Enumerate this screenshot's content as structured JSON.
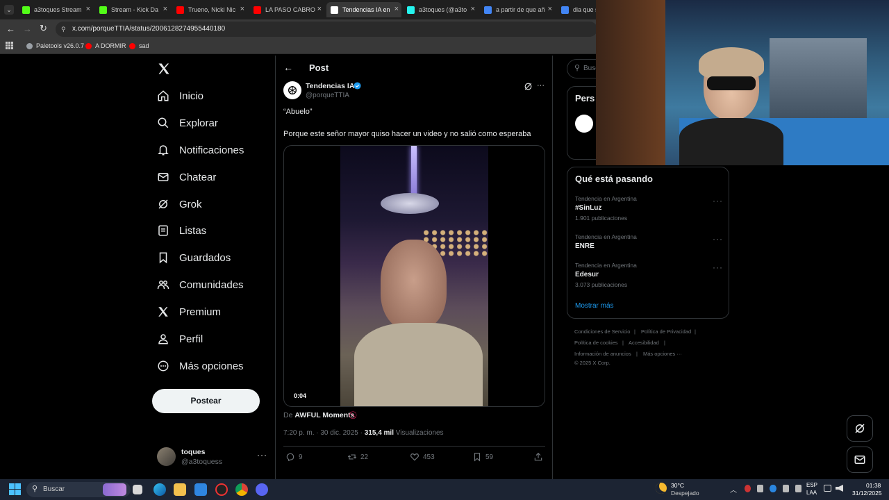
{
  "browser": {
    "tabs": [
      {
        "label": "a3toques Stream",
        "color": "#53fc18"
      },
      {
        "label": "Stream - Kick Da",
        "color": "#53fc18"
      },
      {
        "label": "Trueno, Nicki Nic",
        "color": "#ff0000"
      },
      {
        "label": "LA PASO CABRO",
        "color": "#ff0000"
      },
      {
        "label": "Tendencias IA en",
        "color": "#ffffff"
      },
      {
        "label": "a3toques (@a3to",
        "color": "#25f4ee"
      },
      {
        "label": "a partir de que añ",
        "color": "#4285f4"
      },
      {
        "label": "dia que se",
        "color": "#4285f4"
      }
    ],
    "url": "x.com/porqueTTIA/status/2006128274955440180",
    "bookmarks": [
      {
        "label": "Paletools v26.0.7",
        "color": "#9aa0a6"
      },
      {
        "label": "A DORMIR",
        "color": "#ff0000"
      },
      {
        "label": "sad",
        "color": "#ff0000"
      }
    ]
  },
  "nav": {
    "items": [
      {
        "label": "Inicio",
        "icon": "home-icon"
      },
      {
        "label": "Explorar",
        "icon": "search-icon"
      },
      {
        "label": "Notificaciones",
        "icon": "bell-icon"
      },
      {
        "label": "Chatear",
        "icon": "mail-icon"
      },
      {
        "label": "Grok",
        "icon": "grok-icon"
      },
      {
        "label": "Listas",
        "icon": "list-icon"
      },
      {
        "label": "Guardados",
        "icon": "bookmark-icon"
      },
      {
        "label": "Comunidades",
        "icon": "people-icon"
      },
      {
        "label": "Premium",
        "icon": "x-icon"
      },
      {
        "label": "Perfil",
        "icon": "person-icon"
      },
      {
        "label": "Más opciones",
        "icon": "more-circle-icon"
      }
    ],
    "post_label": "Postear",
    "account": {
      "name": "toques",
      "handle": "@a3toquess"
    }
  },
  "post": {
    "header_title": "Post",
    "author_name": "Tendencias IA",
    "author_handle": "@porqueTTIA",
    "text_line1": "“Abuelo”",
    "text_line2": "Porque este señor mayor quiso hacer un video y no salió como esperaba",
    "video_time": "0:04",
    "source_prefix": "De",
    "source_name": "AWFUL Moments",
    "timestamp": "7:20 p. m. · 30 dic. 2025 ·",
    "views_count": "315,4 mil",
    "views_label": "Visualizaciones",
    "replies": "9",
    "reposts": "22",
    "likes": "453",
    "bookmarks": "59"
  },
  "sidebar": {
    "search_placeholder": "Busc",
    "persons_title": "Pers",
    "trends_title": "Qué está pasando",
    "trends": [
      {
        "category": "Tendencia en Argentina",
        "name": "#SinLuz",
        "count": "1.901 publicaciones"
      },
      {
        "category": "Tendencia en Argentina",
        "name": "ENRE",
        "count": ""
      },
      {
        "category": "Tendencia en Argentina",
        "name": "Edesur",
        "count": "3.073 publicaciones"
      }
    ],
    "show_more": "Mostrar más",
    "footer": {
      "terms": "Condiciones de Servicio",
      "privacy": "Política de Privacidad",
      "cookies": "Política de cookies",
      "accessibility": "Accesibilidad",
      "ads": "Información de anuncios",
      "more": "Más opciones ···",
      "copyright": "© 2025 X Corp."
    }
  },
  "taskbar": {
    "search_placeholder": "Buscar",
    "weather_temp": "30°C",
    "weather_desc": "Despejado",
    "lang_top": "ESP",
    "lang_bottom": "LAA",
    "time": "01:38",
    "date": "31/12/2025"
  },
  "colors": {
    "accent": "#1d9bf0",
    "verified": "#1d9bf0",
    "link": "#1d9bf0"
  }
}
